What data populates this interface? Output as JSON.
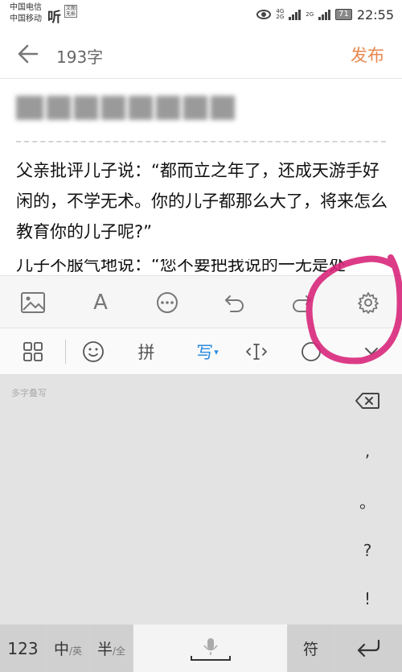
{
  "status_bar": {
    "carrier_1": "中国电信",
    "carrier_2": "中国移动",
    "hd_badge": "听",
    "hd_small_1": "文图",
    "hd_small_2": "无损",
    "net_1": "4G",
    "net_1b": "2G",
    "net_2": "2G",
    "battery": "71",
    "time": "22:55"
  },
  "header": {
    "back_icon": "arrow-left-icon",
    "word_count": "193字",
    "publish_label": "发布",
    "publish_color": "#e8874d"
  },
  "editor": {
    "body_paragraph_1": "父亲批评儿子说：“都而立之年了，还成天游手好闲的，不学无术。你的儿子都那么大了，将来怎么教育你的儿子呢?”",
    "body_paragraph_2_partial": "儿子不服气地说：“您不要把我说的一无是处"
  },
  "format_toolbar": {
    "items": [
      "image-icon",
      "font-icon",
      "more-icon",
      "undo-icon",
      "redo-icon",
      "settings-icon"
    ],
    "font_glyph": "A"
  },
  "keyboard": {
    "candidate_bar": {
      "pinyin_label": "拼",
      "handwriting_label": "写",
      "caret": "▾"
    },
    "hint": "多字叠写",
    "side_keys": [
      ",",
      "。",
      "?",
      "!"
    ],
    "bottom": {
      "num_label": "123",
      "cn_main": "中",
      "cn_sub": "/英",
      "half_main": "半",
      "half_sub": "/全",
      "symbol_label": "符"
    }
  },
  "annotation_color": "#d8277a"
}
